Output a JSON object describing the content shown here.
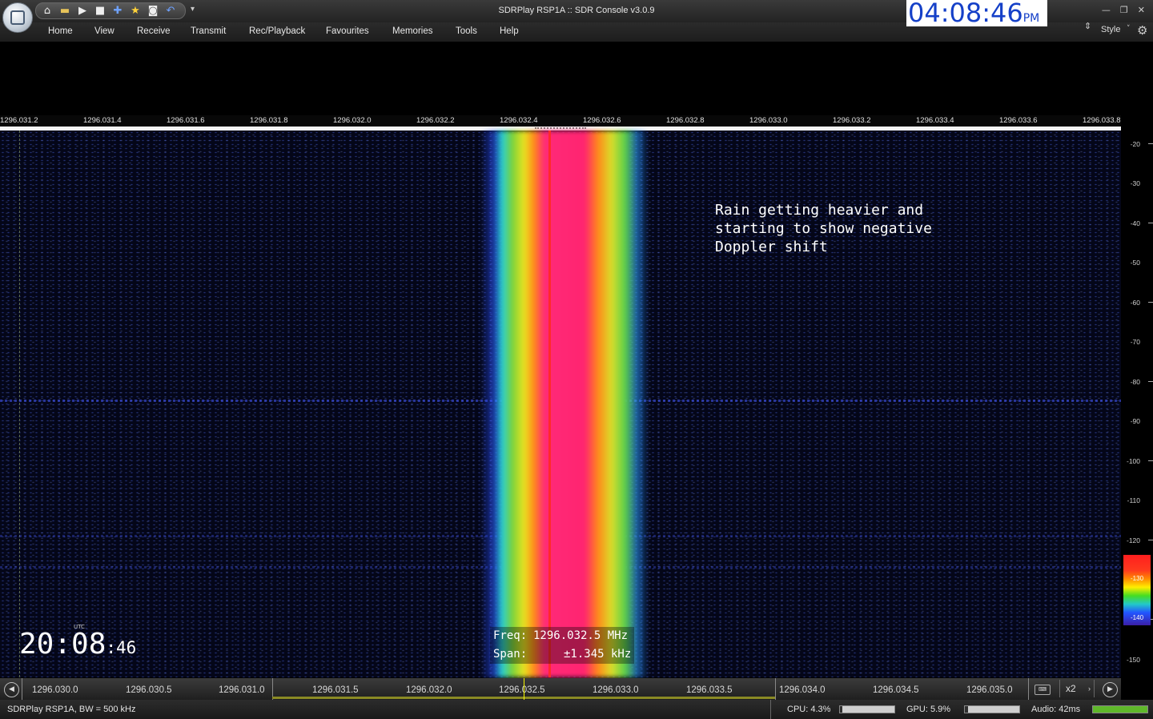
{
  "window": {
    "title": "SDRPlay RSP1A :: SDR Console v3.0.9",
    "minimize_icon": "—",
    "restore_icon": "❐",
    "close_icon": "✕",
    "qat_more_icon": "▾"
  },
  "clock": {
    "time": "04:08:46",
    "ampm": "PM"
  },
  "quick_access": [
    {
      "name": "home-icon",
      "glyph": "⌂"
    },
    {
      "name": "folder-icon",
      "glyph": "▬"
    },
    {
      "name": "play-icon",
      "glyph": "▶"
    },
    {
      "name": "stop-icon",
      "glyph": "■"
    },
    {
      "name": "add-icon",
      "glyph": "✚"
    },
    {
      "name": "favourite-star-icon",
      "glyph": "★"
    },
    {
      "name": "camera-icon",
      "glyph": "◙"
    },
    {
      "name": "undo-icon",
      "glyph": "↶"
    }
  ],
  "menu": [
    "Home",
    "View",
    "Receive",
    "Transmit",
    "Rec/Playback",
    "Favourites",
    "Memories",
    "Tools",
    "Help"
  ],
  "style_menu": {
    "label": "Style",
    "updown_icon": "⇕",
    "caret": "˅",
    "gear_icon": "⚙"
  },
  "top_scale": [
    "1296.031.2",
    "1296.031.4",
    "1296.031.6",
    "1296.031.8",
    "1296.032.0",
    "1296.032.2",
    "1296.032.4",
    "1296.032.6",
    "1296.032.8",
    "1296.033.0",
    "1296.033.2",
    "1296.033.4",
    "1296.033.6",
    "1296.033.8"
  ],
  "db_scale": [
    "-20",
    "-30",
    "-40",
    "-50",
    "-60",
    "-70",
    "-80",
    "-90",
    "-100",
    "-110",
    "-120",
    "-130",
    "-140",
    "-150"
  ],
  "colorbar": {
    "top_label": "-130",
    "bottom_label": "-140"
  },
  "annotation": "Rain getting heavier and\nstarting to show negative\nDoppler shift",
  "utc": {
    "label": "UTC",
    "hm": "20:08",
    "sec": ":46"
  },
  "info": {
    "freq_label": "Freq:",
    "freq_value": "1296.032.5 MHz",
    "span_label": "Span:",
    "span_value": "±1.345 kHz"
  },
  "bottom_scale": [
    "1296.030.0",
    "1296.030.5",
    "1296.031.0",
    "1296.031.5",
    "1296.032.0",
    "1296.032.5",
    "1296.033.0",
    "1296.033.5",
    "1296.034.0",
    "1296.034.5",
    "1296.035.0"
  ],
  "bottom_controls": {
    "zoom": "x2",
    "zoom_arrow": "›",
    "nav_left": "◀",
    "nav_right": "▶",
    "keyboard": "⌨"
  },
  "status": {
    "device": "SDRPlay RSP1A, BW = 500 kHz",
    "cpu": "CPU: 4.3%",
    "cpu_level": 0.043,
    "gpu": "GPU: 5.9%",
    "gpu_level": 0.059,
    "audio": "Audio: 42ms"
  },
  "colors": {
    "accent_clock": "#1540c8",
    "signal_core": "#ff2470",
    "audio_meter": "#5fb82a"
  }
}
